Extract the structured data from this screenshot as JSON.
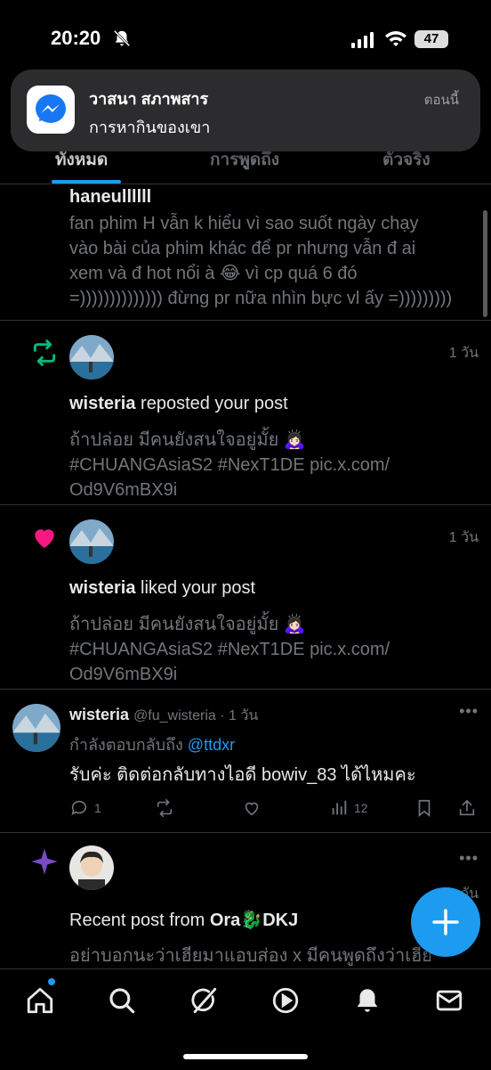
{
  "status_bar": {
    "time": "20:20",
    "battery": "47"
  },
  "notification": {
    "app_icon": "messenger-icon",
    "title": "วาสนา สภาพสาร",
    "body": "การหากินของเขา",
    "time": "ตอนนี้"
  },
  "tabs": [
    {
      "label": "ทั้งหมด",
      "active": true
    },
    {
      "label": "การพูดถึง",
      "active": false
    },
    {
      "label": "ตัวจริง",
      "active": false
    }
  ],
  "feed": {
    "item0": {
      "author": "haneullllll",
      "line1": "fan phim H vẫn k hiểu vì sao suốt ngày chạy",
      "line2": "vào bài của phim khác để pr nhưng vẫn đ ai",
      "line3": "xem và đ hot nổi à 😂 vì cp quá 6 đó",
      "line4": "=)))))))))))))) đừng pr nữa nhìn bực vl ấy =)))))))))"
    },
    "item1": {
      "icon": "repost-icon",
      "age": "1 วัน",
      "actor": "wisteria",
      "action": " reposted your post",
      "line1": "ถ้าปล่อย มีคนยังสนใจอยู่มั้ย 🙇🏻‍♀️",
      "line2": "#CHUANGAsiaS2 #NexT1DE pic.x.com/",
      "line3": "Od9V6mBX9i"
    },
    "item2": {
      "icon": "heart-icon",
      "age": "1 วัน",
      "actor": "wisteria",
      "action": " liked your post",
      "line1": "ถ้าปล่อย มีคนยังสนใจอยู่มั้ย 🙇🏻‍♀️",
      "line2": "#CHUANGAsiaS2 #NexT1DE pic.x.com/",
      "line3": "Od9V6mBX9i"
    },
    "item3": {
      "name": "wisteria",
      "handle": "@fu_wisteria · 1 วัน",
      "replying": "กำลังตอบกลับถึง ",
      "reply_to": "@ttdxr",
      "text": "รับค่ะ ติดต่อกลับทางไอดี bowiv_83 ได้ไหมคะ",
      "replies": "1",
      "views": "12"
    },
    "item4": {
      "icon": "sparkle-icon",
      "age": "1 วัน",
      "label": "Recent post from ",
      "source": "Ora🐉DKJ",
      "preview": "อย่าบอกนะว่าเฮียมาแอบส่อง x มีคนพูดถึงว่าเฮีย"
    }
  },
  "colors": {
    "accent": "#1d9bf0",
    "repost": "#00ba7c",
    "like": "#f91880",
    "sparkle": "#794bc4"
  }
}
